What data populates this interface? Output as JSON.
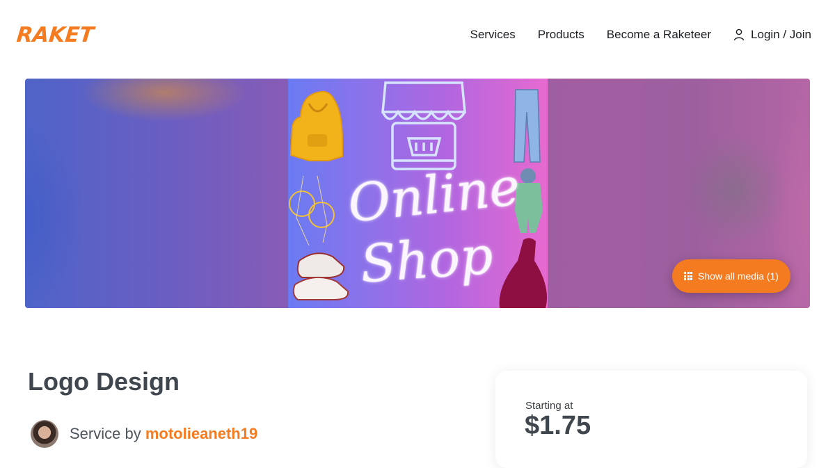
{
  "brand": {
    "name": "RAKET",
    "color": "#f47b20"
  },
  "nav": {
    "items": [
      {
        "label": "Services"
      },
      {
        "label": "Products"
      },
      {
        "label": "Become a Raketeer"
      }
    ],
    "login_label": "Login / Join",
    "login_icon": "user-icon"
  },
  "hero": {
    "image_text_line1": "Online",
    "image_text_line2": "Shop",
    "media_button_label": "Show all media (1)",
    "media_button_icon": "grid-icon"
  },
  "listing": {
    "title": "Logo Design",
    "service_by_label": "Service by",
    "username": "motolieaneth19"
  },
  "pricing": {
    "starting_label": "Starting at",
    "price": "$1.75"
  }
}
